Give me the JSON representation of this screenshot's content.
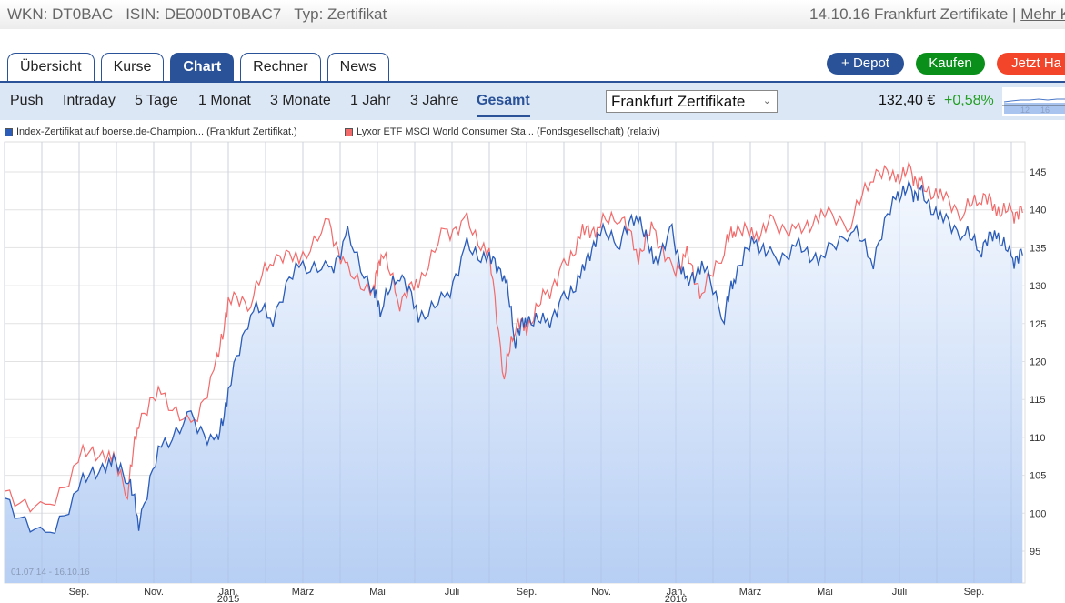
{
  "header": {
    "wkn": "WKN: DT0BAC",
    "isin": "ISIN: DE000DT0BAC7",
    "typ": "Typ: Zertifikat",
    "info": "14.10.16 Frankfurt Zertifikate |",
    "more_link": "Mehr K"
  },
  "tabs": [
    {
      "label": "Übersicht"
    },
    {
      "label": "Kurse"
    },
    {
      "label": "Chart",
      "active": true
    },
    {
      "label": "Rechner"
    },
    {
      "label": "News"
    }
  ],
  "actions": {
    "depot": "+ Depot",
    "kaufen": "Kaufen",
    "handeln": "Jetzt Ha"
  },
  "colors": {
    "brand": "#2a5298",
    "green": "#0a8f1a",
    "red": "#f2452a",
    "blue_series": "#2b5cb8",
    "red_series": "#f26a6a"
  },
  "ranges": [
    {
      "label": "Push"
    },
    {
      "label": "Intraday"
    },
    {
      "label": "5 Tage"
    },
    {
      "label": "1 Monat"
    },
    {
      "label": "3 Monate"
    },
    {
      "label": "1 Jahr"
    },
    {
      "label": "3 Jahre"
    },
    {
      "label": "Gesamt",
      "active": true
    }
  ],
  "exchange_select": {
    "value": "Frankfurt Zertifikate"
  },
  "quote": {
    "price": "132,40 €",
    "change": "+0,58%"
  },
  "mini_chart": {
    "labels": [
      "12",
      "16"
    ]
  },
  "chart_data": {
    "type": "line",
    "range_label": "01.07.14 - 16.10.16",
    "ylim": [
      91,
      149
    ],
    "yticks": [
      95,
      100,
      105,
      110,
      115,
      120,
      125,
      130,
      135,
      140,
      145
    ],
    "xticks": [
      {
        "m": 2,
        "label": "Sep."
      },
      {
        "m": 4,
        "label": "Nov."
      },
      {
        "m": 6,
        "label": "Jan.",
        "sub": "2015"
      },
      {
        "m": 8,
        "label": "März"
      },
      {
        "m": 10,
        "label": "Mai"
      },
      {
        "m": 12,
        "label": "Juli"
      },
      {
        "m": 14,
        "label": "Sep."
      },
      {
        "m": 16,
        "label": "Nov."
      },
      {
        "m": 18,
        "label": "Jan.",
        "sub": "2016"
      },
      {
        "m": 20,
        "label": "März"
      },
      {
        "m": 22,
        "label": "Mai"
      },
      {
        "m": 24,
        "label": "Juli"
      },
      {
        "m": 26,
        "label": "Sep."
      }
    ],
    "x_months": [
      0,
      1.1,
      2.1,
      2.8,
      3.3,
      3.6,
      4.2,
      5.0,
      5.7,
      6.0,
      6.6,
      7.2,
      7.9,
      8.7,
      9.2,
      9.9,
      10.1,
      10.6,
      11.1,
      11.8,
      12.4,
      13.0,
      13.4,
      13.7,
      14.0,
      14.5,
      15.0,
      15.5,
      15.9,
      16.5,
      17.0,
      17.4,
      17.9,
      18.3,
      18.7,
      19.3,
      19.6,
      20.1,
      20.6,
      21.3,
      21.9,
      22.7,
      23.3,
      23.9,
      24.3,
      24.6,
      25.1,
      25.7,
      26.2,
      26.6,
      27.0,
      27.3
    ],
    "series": [
      {
        "name": "Index-Zertifikat auf boerse.de-Champion... (Frankfurt Zertifikat.)",
        "color": "#2b5cb8",
        "values": [
          102,
          96.3,
          104,
          107,
          105,
          99,
          109,
          112.5,
          109,
          116,
          127,
          126,
          133,
          131.7,
          136.5,
          129,
          127,
          132,
          126,
          128,
          135,
          133.5,
          131.7,
          123,
          125.7,
          125,
          128,
          131.7,
          137,
          136,
          139.5,
          133,
          137,
          130,
          133,
          126,
          131.7,
          136,
          133.5,
          135,
          133.5,
          137.7,
          133.5,
          142,
          142.5,
          142,
          139,
          137,
          135,
          137,
          133.5,
          134
        ]
      },
      {
        "name": "Lyxor ETF MSCI World Consumer Sta... (Fondsgesellschaft) (relativ)",
        "color": "#f26a6a",
        "values": [
          102.9,
          100,
          107.7,
          108,
          103,
          112.5,
          116,
          111,
          119.7,
          128,
          128,
          134,
          133.5,
          138,
          131.7,
          129.3,
          134.7,
          128,
          130.5,
          137,
          138.3,
          134,
          118,
          125,
          124.5,
          128.7,
          132.3,
          137,
          137.7,
          139.5,
          134,
          137.7,
          131.7,
          134,
          128.7,
          135,
          137.7,
          136.5,
          138.3,
          137,
          139.5,
          138.3,
          145,
          144.3,
          145,
          143,
          142,
          139.5,
          142,
          140,
          139.6,
          139.6
        ]
      }
    ]
  }
}
